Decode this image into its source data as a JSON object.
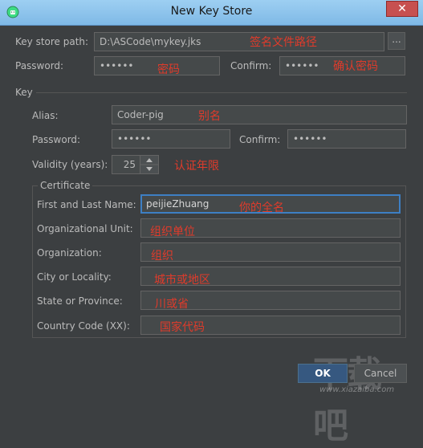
{
  "window": {
    "title": "New Key Store",
    "close_symbol": "✕"
  },
  "keystore": {
    "path_label": "Key store path:",
    "path_value": "D:\\ASCode\\mykey.jks",
    "browse_label": "...",
    "password_label": "Password:",
    "password_value": "••••••",
    "confirm_label": "Confirm:",
    "confirm_value": "••••••"
  },
  "key": {
    "section_label": "Key",
    "alias_label": "Alias:",
    "alias_value": "Coder-pig",
    "password_label": "Password:",
    "password_value": "••••••",
    "confirm_label": "Confirm:",
    "confirm_value": "••••••",
    "validity_label": "Validity (years):",
    "validity_value": "25"
  },
  "certificate": {
    "group_label": "Certificate",
    "first_last_label": "First and Last Name:",
    "first_last_value": "peijieZhuang",
    "org_unit_label": "Organizational Unit:",
    "org_unit_value": "",
    "org_label": "Organization:",
    "org_value": "",
    "city_label": "City or Locality:",
    "city_value": "",
    "state_label": "State or Province:",
    "state_value": "",
    "country_label": "Country Code (XX):",
    "country_value": ""
  },
  "annotations": {
    "path": "签名文件路径",
    "password": "密码",
    "confirm": "确认密码",
    "alias": "别名",
    "validity": "认证年限",
    "name": "你的全名",
    "org_unit": "组织单位",
    "org": "组织",
    "city": "城市或地区",
    "state": "川或省",
    "country": "国家代码"
  },
  "buttons": {
    "ok": "OK",
    "cancel": "Cancel"
  },
  "watermark": {
    "logo": "下载吧",
    "url": "www.xiazaiba.com"
  },
  "colors": {
    "annotation": "#e03b2b",
    "focus_border": "#3d7fc4",
    "ok_button": "#365880"
  }
}
